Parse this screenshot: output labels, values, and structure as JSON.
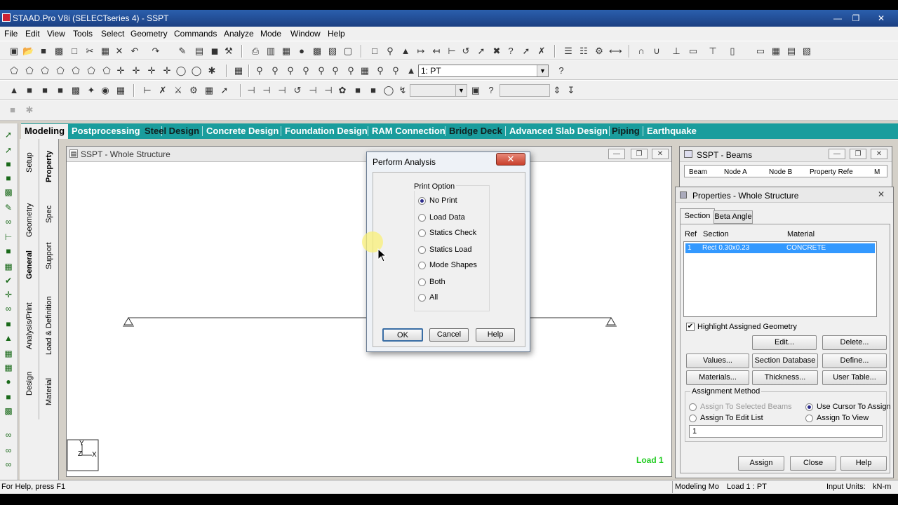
{
  "window": {
    "title": "STAAD.Pro V8i (SELECTseries 4) - SSPT"
  },
  "menu": [
    "File",
    "Edit",
    "View",
    "Tools",
    "Select",
    "Geometry",
    "Commands",
    "Analyze",
    "Mode",
    "Window",
    "Help"
  ],
  "toolbar": {
    "load_case_value": "1: PT"
  },
  "mode_tabs": [
    "Modeling",
    "Postprocessing",
    "Steel Design",
    "Concrete Design",
    "Foundation Design",
    "RAM Connection",
    "Bridge Deck",
    "Advanced Slab Design",
    "Piping",
    "Earthquake"
  ],
  "page_tabs_outer": [
    "Setup",
    "Geometry",
    "General",
    "Analysis/Print",
    "Design"
  ],
  "page_tabs_inner": [
    "Property",
    "Spec",
    "Support",
    "Load & Definition",
    "Material"
  ],
  "main_view": {
    "title": "SSPT - Whole Structure",
    "load_label": "Load 1",
    "axis_y": "Y",
    "axis_z": "Z",
    "axis_x": "X"
  },
  "dialog": {
    "title": "Perform Analysis",
    "group_label": "Print Option",
    "options": [
      "No Print",
      "Load Data",
      "Statics Check",
      "Statics Load",
      "Mode Shapes",
      "Both",
      "All"
    ],
    "selected": "No Print",
    "ok_label": "OK",
    "cancel_label": "Cancel",
    "help_label": "Help"
  },
  "beams_window": {
    "title": "SSPT - Beams",
    "columns": [
      "Beam",
      "Node A",
      "Node B",
      "Property Refe",
      "M"
    ]
  },
  "properties": {
    "title": "Properties - Whole Structure",
    "tabs": [
      "Section",
      "Beta Angle"
    ],
    "columns": [
      "Ref",
      "Section",
      "Material"
    ],
    "rows": [
      {
        "ref": "1",
        "section": "Rect 0.30x0.23",
        "material": "CONCRETE"
      }
    ],
    "highlight_label": "Highlight Assigned Geometry",
    "buttons": {
      "edit": "Edit...",
      "delete": "Delete...",
      "values": "Values...",
      "section_db": "Section Database",
      "define": "Define...",
      "materials": "Materials...",
      "thickness": "Thickness...",
      "user_table": "User Table..."
    },
    "assign_method_label": "Assignment Method",
    "assign_options": [
      "Assign To Selected Beams",
      "Use Cursor To Assign",
      "Assign To Edit List",
      "Assign To View"
    ],
    "edit_list_value": "1",
    "assign_label": "Assign",
    "close_label": "Close",
    "help_label": "Help"
  },
  "status": {
    "help": "For Help, press F1",
    "mode": "Modeling Mo",
    "load": "Load 1 : PT",
    "units_label": "Input Units:",
    "units_value": "kN-m"
  },
  "colors": {
    "mode_bar": "#1a9d9d",
    "selection": "#3399ff",
    "load_label": "#22cc22"
  }
}
